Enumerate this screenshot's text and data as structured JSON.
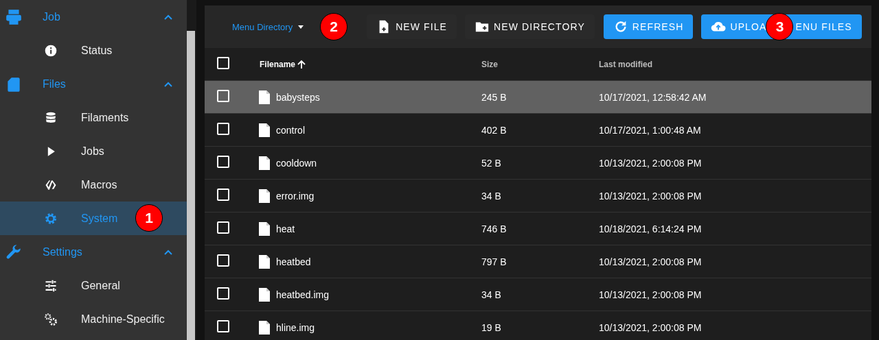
{
  "sidebar": {
    "items": [
      {
        "label": "Job",
        "expanded": true,
        "selected": false,
        "kind": "printer",
        "children": [
          {
            "label": "Status",
            "selected": false,
            "kind": "info"
          }
        ]
      },
      {
        "label": "Files",
        "expanded": true,
        "selected": false,
        "kind": "sdcard",
        "children": [
          {
            "label": "Filaments",
            "selected": false,
            "kind": "database"
          },
          {
            "label": "Jobs",
            "selected": false,
            "kind": "play"
          },
          {
            "label": "Macros",
            "selected": false,
            "kind": "code"
          },
          {
            "label": "System",
            "selected": true,
            "kind": "gear",
            "badge": "1"
          }
        ]
      },
      {
        "label": "Settings",
        "expanded": true,
        "selected": false,
        "kind": "wrench",
        "children": [
          {
            "label": "General",
            "selected": false,
            "kind": "sliders"
          },
          {
            "label": "Machine-Specific",
            "selected": false,
            "kind": "gears"
          }
        ]
      }
    ]
  },
  "toolbar": {
    "directory": {
      "label": "Menu Directory",
      "badge": "2"
    },
    "buttons": [
      {
        "kind": "new-file",
        "label_parts": [
          "NEW FILE"
        ],
        "primary": false
      },
      {
        "kind": "new-directory",
        "label_parts": [
          "NEW DIRECTORY"
        ],
        "primary": false
      },
      {
        "kind": "refresh",
        "label_parts": [
          "REFRESH"
        ],
        "primary": true
      },
      {
        "kind": "upload",
        "label_parts": [
          "UPLOA",
          "ENU FILES"
        ],
        "primary": true,
        "badge": "3"
      }
    ]
  },
  "table": {
    "all_checked": false,
    "columns": [
      {
        "label": "Filename",
        "sorted": true
      },
      {
        "label": "Size",
        "sorted": false
      },
      {
        "label": "Last modified",
        "sorted": false
      }
    ],
    "rows": [
      {
        "name": "babysteps",
        "size": "245 B",
        "modified": "10/17/2021, 12:58:42 AM",
        "selected": true,
        "checked": false
      },
      {
        "name": "control",
        "size": "402 B",
        "modified": "10/17/2021, 1:00:48 AM",
        "selected": false,
        "checked": false
      },
      {
        "name": "cooldown",
        "size": "52 B",
        "modified": "10/13/2021, 2:00:08 PM",
        "selected": false,
        "checked": false
      },
      {
        "name": "error.img",
        "size": "34 B",
        "modified": "10/13/2021, 2:00:08 PM",
        "selected": false,
        "checked": false
      },
      {
        "name": "heat",
        "size": "746 B",
        "modified": "10/18/2021, 6:14:24 PM",
        "selected": false,
        "checked": false
      },
      {
        "name": "heatbed",
        "size": "797 B",
        "modified": "10/13/2021, 2:00:08 PM",
        "selected": false,
        "checked": false
      },
      {
        "name": "heatbed.img",
        "size": "34 B",
        "modified": "10/13/2021, 2:00:08 PM",
        "selected": false,
        "checked": false
      },
      {
        "name": "hline.img",
        "size": "19 B",
        "modified": "10/13/2021, 2:00:08 PM",
        "selected": false,
        "checked": false
      }
    ]
  }
}
